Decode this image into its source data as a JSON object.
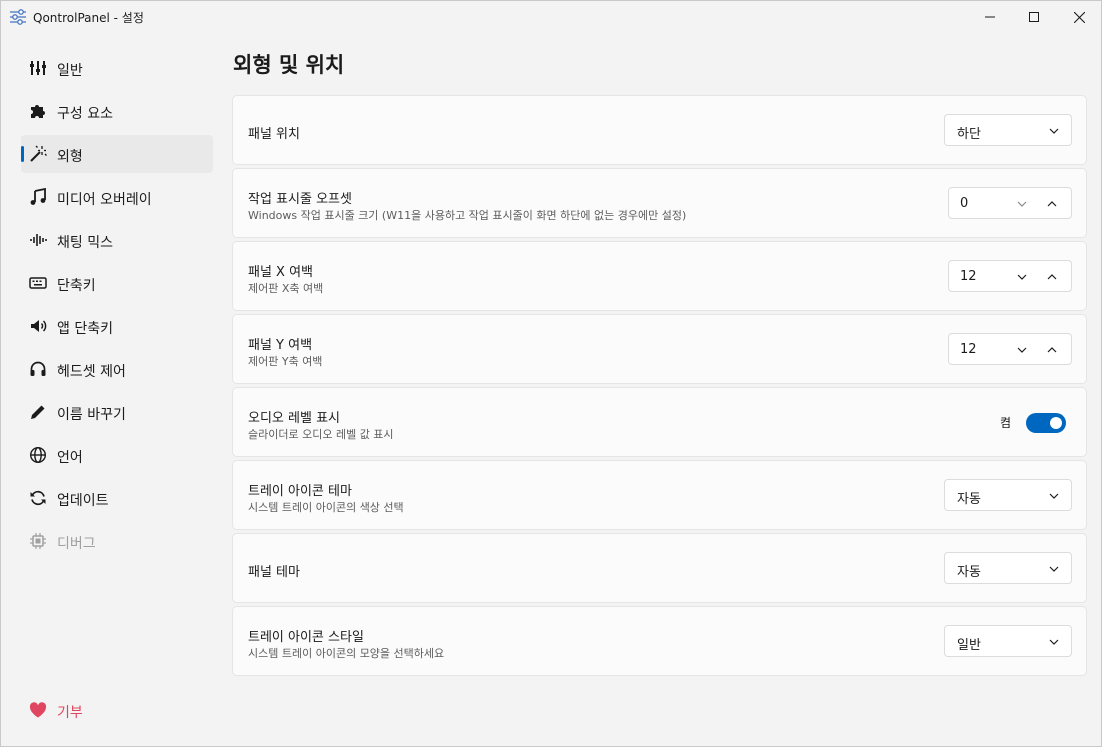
{
  "window": {
    "title": "QontrolPanel - 설정",
    "controls": [
      "minimize-icon",
      "maximize-icon",
      "close-icon"
    ]
  },
  "sidebar": {
    "items": [
      {
        "label": "일반",
        "icon": "sliders-icon",
        "active": false,
        "disabled": false
      },
      {
        "label": "구성 요소",
        "icon": "puzzle-icon",
        "active": false,
        "disabled": false
      },
      {
        "label": "외형",
        "icon": "magic-wand-icon",
        "active": true,
        "disabled": false
      },
      {
        "label": "미디어 오버레이",
        "icon": "music-note-icon",
        "active": false,
        "disabled": false
      },
      {
        "label": "채팅 믹스",
        "icon": "waveform-icon",
        "active": false,
        "disabled": false
      },
      {
        "label": "단축키",
        "icon": "keyboard-icon",
        "active": false,
        "disabled": false
      },
      {
        "label": "앱 단축키",
        "icon": "speaker-icon",
        "active": false,
        "disabled": false
      },
      {
        "label": "헤드셋 제어",
        "icon": "headset-icon",
        "active": false,
        "disabled": false
      },
      {
        "label": "이름 바꾸기",
        "icon": "pencil-icon",
        "active": false,
        "disabled": false
      },
      {
        "label": "언어",
        "icon": "globe-icon",
        "active": false,
        "disabled": false
      },
      {
        "label": "업데이트",
        "icon": "refresh-icon",
        "active": false,
        "disabled": false
      },
      {
        "label": "디버그",
        "icon": "chip-icon",
        "active": false,
        "disabled": true
      }
    ],
    "donate": {
      "label": "기부",
      "icon": "heart-icon"
    }
  },
  "page": {
    "title": "외형 및 위치",
    "settings": [
      {
        "title": "패널 위치",
        "description": "",
        "control": "combo",
        "value": "하단"
      },
      {
        "title": "작업 표시줄 오프셋",
        "description": "Windows 작업 표시줄 크기 (W11을 사용하고 작업 표시줄이 화면 하단에 없는 경우에만 설정)",
        "control": "spin",
        "value": "0"
      },
      {
        "title": "패널 X 여백",
        "description": "제어판 X축 여백",
        "control": "spin",
        "value": "12"
      },
      {
        "title": "패널 Y 여백",
        "description": "제어판 Y축 여백",
        "control": "spin",
        "value": "12"
      },
      {
        "title": "오디오 레벨 표시",
        "description": "슬라이더로 오디오 레벨 값 표시",
        "control": "toggle",
        "value": "켬",
        "on": true
      },
      {
        "title": "트레이 아이콘 테마",
        "description": "시스템 트레이 아이콘의 색상 선택",
        "control": "combo",
        "value": "자동"
      },
      {
        "title": "패널 테마",
        "description": "",
        "control": "combo",
        "value": "자동"
      },
      {
        "title": "트레이 아이콘 스타일",
        "description": "시스템 트레이 아이콘의 모양을 선택하세요",
        "control": "combo",
        "value": "일반"
      }
    ]
  },
  "colors": {
    "accent": "#0067c0",
    "donate": "#e0465f",
    "background": "#f3f3f3",
    "card": "#fbfbfb"
  }
}
